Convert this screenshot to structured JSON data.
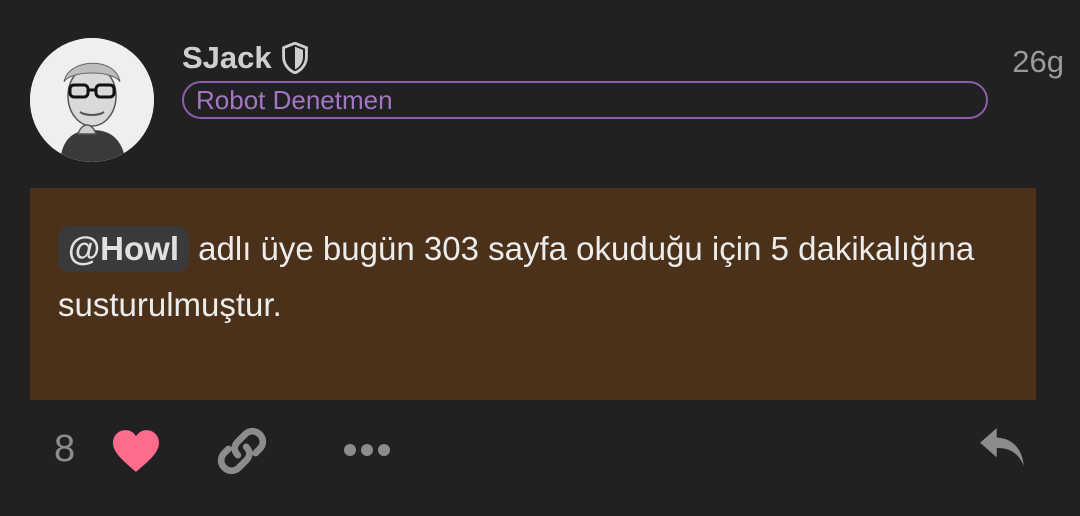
{
  "post": {
    "username": "SJack",
    "time_ago": "26g",
    "badge": "Robot Denetmen",
    "mention": "@Howl",
    "body_text": " adlı üye bugün 303 sayfa okuduğu için 5 dakikalığına susturulmuştur.",
    "background_color": "#4b311a"
  },
  "actions": {
    "like_count": "8",
    "like_color": "#ff6b8b",
    "icons": [
      "heart-icon",
      "link-icon",
      "more-icon",
      "reply-icon"
    ]
  },
  "colors": {
    "badge_accent": "#8e5ca8",
    "page_background": "#212123"
  }
}
